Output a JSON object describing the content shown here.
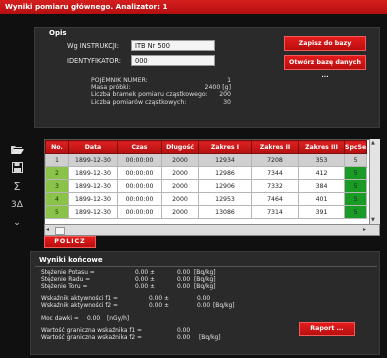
{
  "window": {
    "title": "Wyniki pomiaru głównego. Analizator: 1"
  },
  "description_section": {
    "title": "Opis",
    "instruction_label": "Wg INSTRUKCJI:",
    "instruction_value": "ITB Nr 500",
    "identifier_label": "IDENTYFIKATOR:",
    "identifier_value": "000",
    "info": [
      {
        "label": "POJEMNIK NUMER:",
        "value": "1"
      },
      {
        "label": "Masa próbki:",
        "value": "2400 [g]"
      },
      {
        "label": "Liczba bramek pomiaru cząstkowego:",
        "value": "200"
      },
      {
        "label": "Liczba pomiarów cząstkowych:",
        "value": "30"
      }
    ]
  },
  "buttons": {
    "save_to_db": "Zapisz do bazy",
    "open_db": "Otwórz bazę danych ...",
    "calculate": "POLICZ",
    "report": "Raport ..."
  },
  "toolbar": {
    "icons": [
      "open-folder-icon",
      "save-disk-icon",
      "sigma-icon",
      "three-sigma-icon",
      "chevron-down-icon"
    ],
    "sigma_glyph": "Σ",
    "three_sigma_glyph": "3Δ"
  },
  "table": {
    "headers": [
      "No.",
      "Data",
      "Czas",
      "Długość",
      "Zakres I",
      "Zakres II",
      "Zakres III",
      "SpcSe"
    ],
    "rows": [
      [
        "1",
        "1899-12-30",
        "00:00:00",
        "2000",
        "12934",
        "7208",
        "353",
        "5"
      ],
      [
        "2",
        "1899-12-30",
        "00:00:00",
        "2000",
        "12986",
        "7344",
        "412",
        "5"
      ],
      [
        "3",
        "1899-12-30",
        "00:00:00",
        "2000",
        "12906",
        "7332",
        "384",
        "5"
      ],
      [
        "4",
        "1899-12-30",
        "00:00:00",
        "2000",
        "12953",
        "7464",
        "401",
        "5"
      ],
      [
        "5",
        "1899-12-30",
        "00:00:00",
        "2000",
        "13086",
        "7314",
        "391",
        "5"
      ]
    ]
  },
  "results": {
    "title": "Wyniki końcowe",
    "lines": [
      {
        "label": "Stężenie Potasu  =",
        "value": "0.00 ±",
        "err": "0.00",
        "unit": "[Bq/kg]"
      },
      {
        "label": "Stężenie Radu   =",
        "value": "0.00 ±",
        "err": "0.00",
        "unit": "[Bq/kg]"
      },
      {
        "label": "Stężenie Toru    =",
        "value": "0.00 ±",
        "err": "0.00",
        "unit": "[Bq/kg]"
      },
      {
        "label": "Wskaźnik aktywności f1 =",
        "value": "0.00 ±",
        "err": "0.00",
        "unit": ""
      },
      {
        "label": "Wskaźnik aktywności f2 =",
        "value": "0.00 ±",
        "err": "0.00",
        "unit": "[Bq/kg]"
      },
      {
        "label": "Moc dawki =",
        "value": "0.00",
        "err": "",
        "unit": "[nGy/h]"
      },
      {
        "label": "Wartość graniczna wskaźnika f1 =",
        "value": "0.00",
        "err": "",
        "unit": ""
      },
      {
        "label": "Wartość graniczna wskaźnika f2 =",
        "value": "0.00",
        "err": "",
        "unit": "[Bq/kg]"
      }
    ]
  },
  "colors": {
    "accent": "#d51f1f",
    "panel": "#2a2a2a",
    "background": "#101010",
    "number_cell": "#8bc34a",
    "green_cell": "#1a9b26"
  }
}
